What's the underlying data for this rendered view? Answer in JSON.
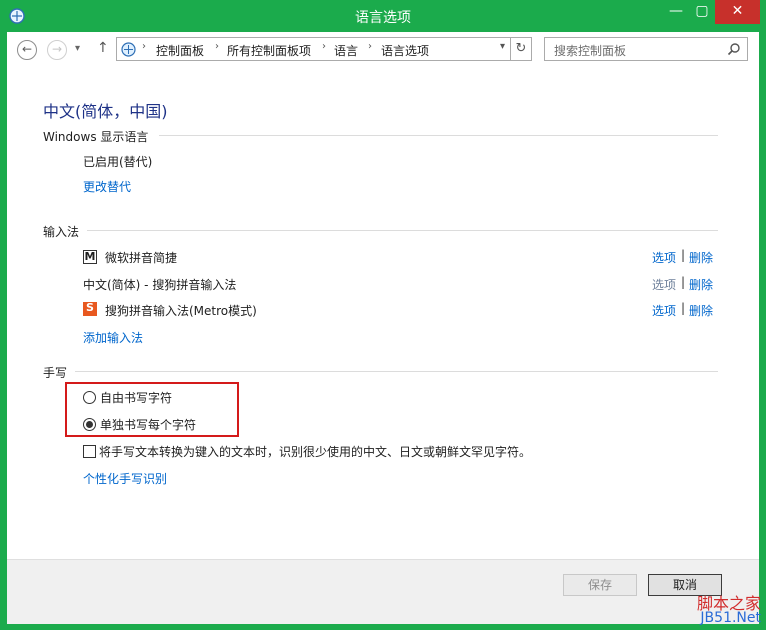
{
  "window": {
    "title": "语言选项",
    "minimize_glyph": "—",
    "maximize_glyph": "▢",
    "close_glyph": "✕"
  },
  "nav": {
    "back_glyph": "←",
    "forward_glyph": "→",
    "dropdown_glyph": "▾",
    "up_glyph": "↑",
    "refresh_glyph": "↻",
    "breadcrumbs": [
      "控制面板",
      "所有控制面板项",
      "语言",
      "语言选项"
    ],
    "separator": "›",
    "search_placeholder": "搜索控制面板"
  },
  "language": {
    "heading": "中文(简体，中国)",
    "display_section": {
      "label": "Windows 显示语言",
      "status": "已启用(替代)",
      "change_link": "更改替代"
    },
    "ime_section": {
      "label": "输入法",
      "items": [
        {
          "name": "微软拼音简捷",
          "icon": "M",
          "options": "选项",
          "sep": "|",
          "delete": "删除"
        },
        {
          "name": "中文(简体) - 搜狗拼音输入法",
          "icon": "",
          "options": "选项",
          "sep": "|",
          "delete": "删除"
        },
        {
          "name": "搜狗拼音输入法(Metro模式)",
          "icon": "S",
          "options": "选项",
          "sep": "|",
          "delete": "删除"
        }
      ],
      "add_link": "添加输入法"
    },
    "handwriting_section": {
      "label": "手写",
      "options": [
        {
          "label": "自由书写字符",
          "selected": false
        },
        {
          "label": "单独书写每个字符",
          "selected": true
        }
      ],
      "convert_checkbox": {
        "label": "将手写文本转换为键入的文本时，识别很少使用的中文、日文或朝鲜文罕见字符。",
        "checked": false
      },
      "personalize_link": "个性化手写识别"
    }
  },
  "footer": {
    "save_label": "保存",
    "cancel_label": "取消"
  },
  "watermark": {
    "line1": "脚本之家",
    "line2": "JB51.Net"
  },
  "colors": {
    "frame": "#1bab4c",
    "close": "#c7302b",
    "link": "#0066cc",
    "heading": "#1e3287",
    "highlight": "#d41a1a"
  }
}
